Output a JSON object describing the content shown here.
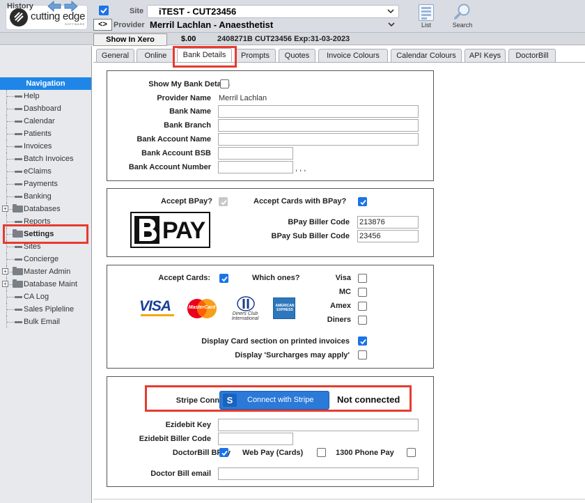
{
  "header": {
    "logo_text": "cutting edge",
    "logo_sub": "SOFTWARE",
    "site_label": "Site",
    "provider_label": "Provider",
    "swap_label": "<>",
    "site_value": "iTEST - CUT23456",
    "provider_value": "Merril Lachlan - Anaesthetist",
    "list_label": "List",
    "search_label": "Search"
  },
  "subbar": {
    "history_label": "History",
    "xero_button": "Show In Xero",
    "balance": "$.00",
    "card_info": "2408271B CUT23456 Exp:31-03-2023"
  },
  "sidebar": {
    "title": "Navigation",
    "items": [
      {
        "label": "Help",
        "type": "leaf"
      },
      {
        "label": "Dashboard",
        "type": "leaf"
      },
      {
        "label": "Calendar",
        "type": "leaf"
      },
      {
        "label": "Patients",
        "type": "leaf"
      },
      {
        "label": "Invoices",
        "type": "leaf"
      },
      {
        "label": "Batch Invoices",
        "type": "leaf"
      },
      {
        "label": "eClaims",
        "type": "leaf"
      },
      {
        "label": "Payments",
        "type": "leaf"
      },
      {
        "label": "Banking",
        "type": "leaf"
      },
      {
        "label": "Databases",
        "type": "folder"
      },
      {
        "label": "Reports",
        "type": "leaf"
      },
      {
        "label": "Settings",
        "type": "folder",
        "active": true
      },
      {
        "label": "Sites",
        "type": "leaf"
      },
      {
        "label": "Concierge",
        "type": "leaf"
      },
      {
        "label": "Master Admin",
        "type": "folder"
      },
      {
        "label": "Database Maint",
        "type": "folder"
      },
      {
        "label": "CA Log",
        "type": "leaf"
      },
      {
        "label": "Sales Pipleline",
        "type": "leaf"
      },
      {
        "label": "Bulk Email",
        "type": "leaf"
      }
    ]
  },
  "tabs": [
    "General",
    "Online",
    "Bank Details",
    "Prompts",
    "Quotes",
    "Invoice Colours",
    "Calendar Colours",
    "API Keys",
    "DoctorBill"
  ],
  "active_tab": "Bank Details",
  "bank": {
    "show_details_label": "Show My Bank Details",
    "provider_name_label": "Provider Name",
    "provider_name_value": "Merril Lachlan",
    "bank_name_label": "Bank Name",
    "bank_branch_label": "Bank Branch",
    "account_name_label": "Bank Account Name",
    "bsb_label": "Bank Account BSB",
    "account_number_label": "Bank Account Number",
    "account_number_suffix": ", , ,"
  },
  "bpay": {
    "accept_label": "Accept BPay?",
    "accept_cards_label": "Accept Cards with BPay?",
    "logo_text": "PAY",
    "biller_code_label": "BPay Biller Code",
    "biller_code_value": "213876",
    "sub_biller_label": "BPay Sub Biller Code",
    "sub_biller_value": "23456"
  },
  "cards": {
    "accept_label": "Accept Cards:",
    "which_label": "Which ones?",
    "visa_label": "Visa",
    "mc_label": "MC",
    "amex_label": "Amex",
    "diners_label": "Diners",
    "visa_logo": "VISA",
    "mc_logo": "MasterCard",
    "diners_logo": "Diners Club International",
    "amex_logo": "AMERICAN EXPRESS",
    "display_section_label": "Display Card section on printed invoices",
    "surcharges_label": "Display 'Surcharges may apply'"
  },
  "stripe": {
    "connect_label": "Stripe Connect",
    "button_label": "Connect with Stripe",
    "button_icon": "S",
    "status": "Not connected",
    "ezidebit_key_label": "Ezidebit Key",
    "ezidebit_biller_label": "Ezidebit Biller Code",
    "doctorbill_bpay_label": "DoctorBill BPay",
    "webpay_label": "Web Pay (Cards)",
    "phonepay_label": "1300 Phone Pay",
    "doctorbill_email_label": "Doctor Bill email"
  },
  "colors": {
    "accent": "#1a73e8",
    "nav_header": "#1f86e8",
    "highlight": "#e53b2f",
    "stripe": "#2b79d8"
  }
}
